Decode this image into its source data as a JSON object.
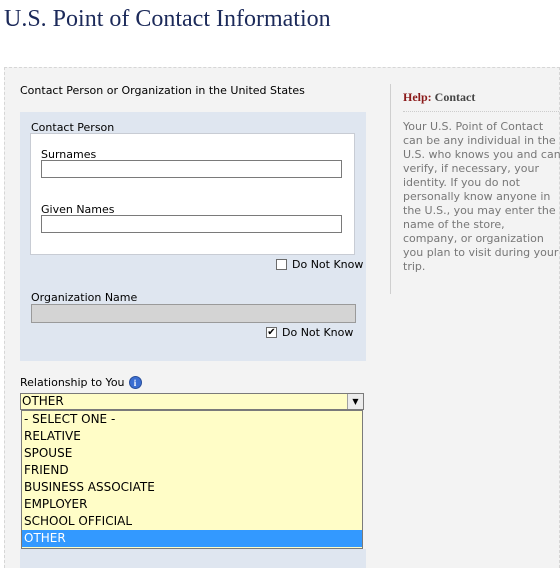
{
  "page": {
    "title": "U.S. Point of Contact Information"
  },
  "form": {
    "section_label": "Contact Person or Organization in the United States",
    "contact_person_label": "Contact Person",
    "surnames_label": "Surnames",
    "surnames_value": "",
    "given_names_label": "Given Names",
    "given_names_value": "",
    "person_do_not_know": {
      "label": "Do Not Know",
      "checked": false
    },
    "organization_label": "Organization Name",
    "organization_value": "",
    "org_do_not_know": {
      "label": "Do Not Know",
      "checked": true
    },
    "relationship_label": "Relationship to You",
    "relationship_selected": "OTHER",
    "relationship_options": [
      "- SELECT ONE -",
      "RELATIVE",
      "SPOUSE",
      "FRIEND",
      "BUSINESS ASSOCIATE",
      "EMPLOYER",
      "SCHOOL OFFICIAL",
      "OTHER"
    ]
  },
  "help": {
    "label": "Help:",
    "topic": "Contact",
    "text": "Your U.S. Point of Contact can be any individual in the U.S. who knows you and can verify, if necessary, your identity. If you do not personally know anyone in the U.S., you may enter the name of the store, company, or organization you plan to visit during your trip."
  },
  "icons": {
    "info": "info-icon",
    "dropdown": "chevron-down-icon",
    "check": "checkmark-icon"
  }
}
